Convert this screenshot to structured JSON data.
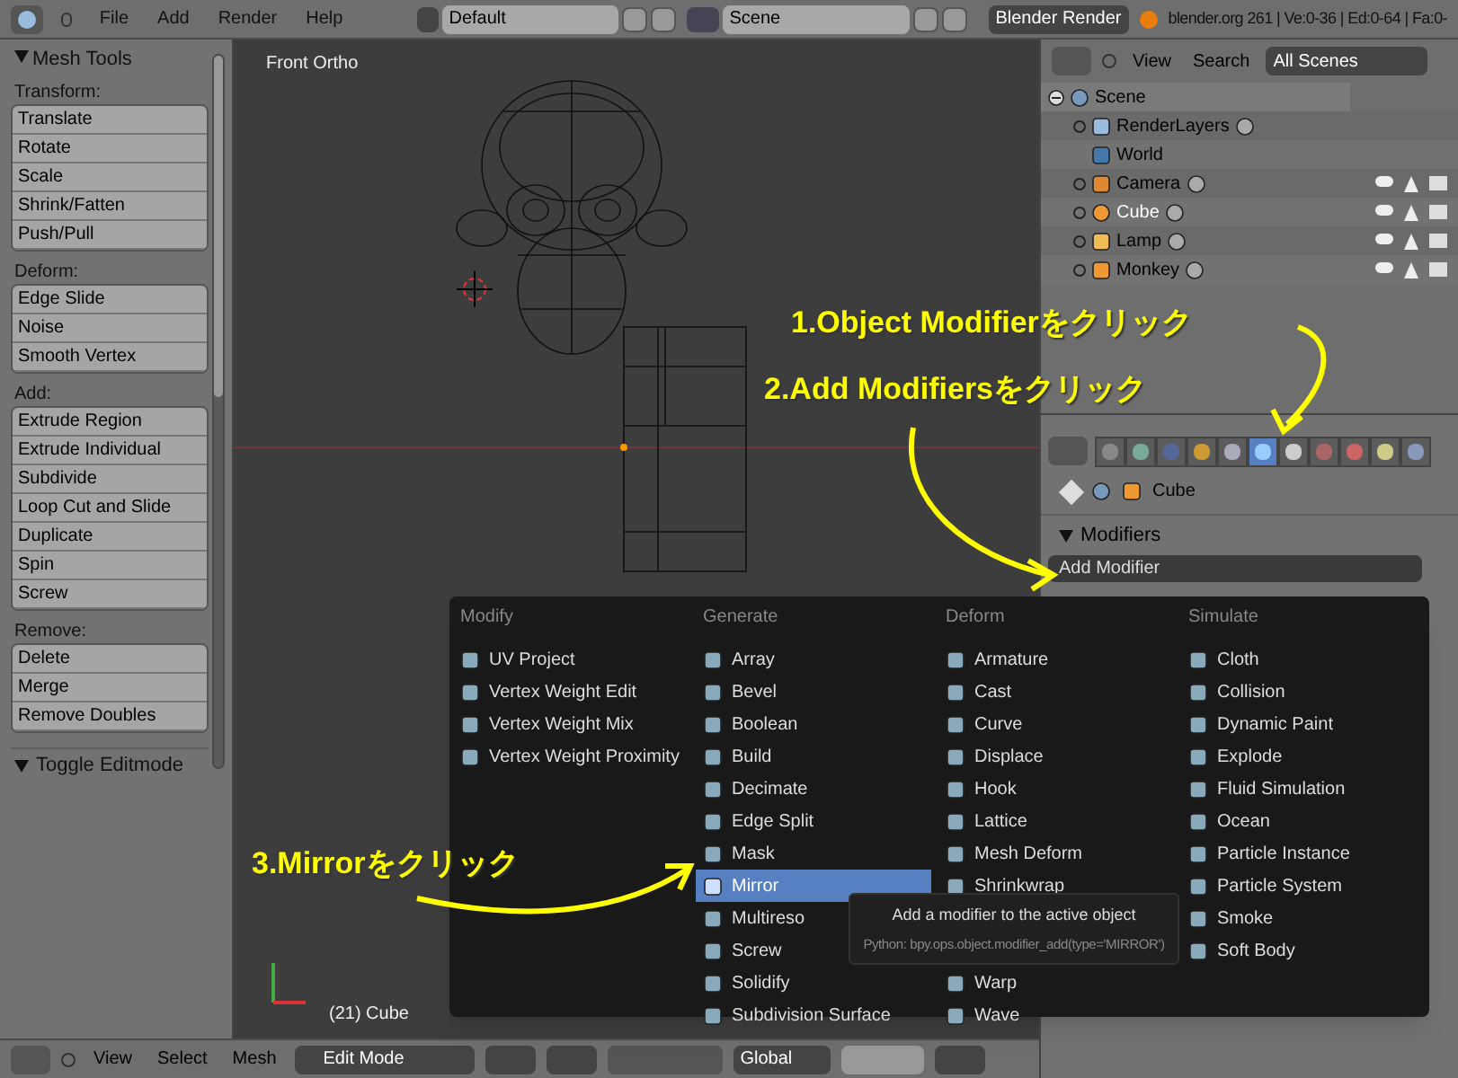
{
  "top_bar": {
    "menus": [
      "File",
      "Add",
      "Render",
      "Help"
    ],
    "layout": "Default",
    "scene": "Scene",
    "engine": "Blender Render",
    "stats": "blender.org 261 | Ve:0-36 | Ed:0-64 | Fa:0-"
  },
  "tool_shelf": {
    "title": "Mesh Tools",
    "groups": [
      {
        "label": "Transform:",
        "buttons": [
          "Translate",
          "Rotate",
          "Scale",
          "Shrink/Fatten",
          "Push/Pull"
        ]
      },
      {
        "label": "Deform:",
        "buttons": [
          "Edge Slide",
          "Noise",
          "Smooth Vertex"
        ]
      },
      {
        "label": "Add:",
        "buttons": [
          "Extrude Region",
          "Extrude Individual",
          "Subdivide",
          "Loop Cut and Slide",
          "Duplicate",
          "Spin",
          "Screw"
        ]
      },
      {
        "label": "Remove:",
        "buttons": [
          "Delete",
          "Merge",
          "Remove Doubles"
        ]
      }
    ],
    "collapsed_panel": "Toggle Editmode"
  },
  "viewport": {
    "view_label": "Front Ortho",
    "object_label": "(21) Cube"
  },
  "outliner": {
    "menus": [
      "View",
      "Search"
    ],
    "filter": "All Scenes",
    "scene": {
      "label": "Scene",
      "expanded": true
    },
    "items": [
      {
        "label": "RenderLayers",
        "kind": "layers",
        "selected": false
      },
      {
        "label": "World",
        "kind": "world",
        "selected": false
      },
      {
        "label": "Camera",
        "kind": "camera",
        "selected": false
      },
      {
        "label": "Cube",
        "kind": "mesh",
        "selected": true
      },
      {
        "label": "Lamp",
        "kind": "lamp",
        "selected": false
      },
      {
        "label": "Monkey",
        "kind": "mesh",
        "selected": false
      }
    ]
  },
  "properties": {
    "tabs": [
      {
        "kind": "render",
        "selected": false
      },
      {
        "kind": "scene",
        "selected": false
      },
      {
        "kind": "world",
        "selected": false
      },
      {
        "kind": "object",
        "selected": false
      },
      {
        "kind": "constraints",
        "selected": false
      },
      {
        "kind": "modifiers",
        "selected": true
      },
      {
        "kind": "data",
        "selected": false
      },
      {
        "kind": "material",
        "selected": false
      },
      {
        "kind": "texture",
        "selected": false
      },
      {
        "kind": "particles",
        "selected": false
      },
      {
        "kind": "physics",
        "selected": false
      }
    ],
    "breadcrumb": "Cube",
    "panel": "Modifiers",
    "dropdown": "Add Modifier"
  },
  "menu": {
    "columns": [
      {
        "title": "Modify",
        "items": [
          {
            "label": "UV Project",
            "selected": false
          },
          {
            "label": "Vertex Weight Edit",
            "selected": false
          },
          {
            "label": "Vertex Weight Mix",
            "selected": false
          },
          {
            "label": "Vertex Weight Proximity",
            "selected": false
          }
        ]
      },
      {
        "title": "Generate",
        "items": [
          {
            "label": "Array",
            "selected": false
          },
          {
            "label": "Bevel",
            "selected": false
          },
          {
            "label": "Boolean",
            "selected": false
          },
          {
            "label": "Build",
            "selected": false
          },
          {
            "label": "Decimate",
            "selected": false
          },
          {
            "label": "Edge Split",
            "selected": false
          },
          {
            "label": "Mask",
            "selected": false
          },
          {
            "label": "Mirror",
            "selected": true
          },
          {
            "label": "Multireso",
            "selected": false
          },
          {
            "label": "Screw",
            "selected": false
          },
          {
            "label": "Solidify",
            "selected": false
          },
          {
            "label": "Subdivision Surface",
            "selected": false
          }
        ]
      },
      {
        "title": "Deform",
        "items": [
          {
            "label": "Armature",
            "selected": false
          },
          {
            "label": "Cast",
            "selected": false
          },
          {
            "label": "Curve",
            "selected": false
          },
          {
            "label": "Displace",
            "selected": false
          },
          {
            "label": "Hook",
            "selected": false
          },
          {
            "label": "Lattice",
            "selected": false
          },
          {
            "label": "Mesh Deform",
            "selected": false
          },
          {
            "label": "Shrinkwrap",
            "selected": false
          }
        ],
        "items_after_tooltip": [
          {
            "label": "Warp",
            "selected": false
          },
          {
            "label": "Wave",
            "selected": false
          }
        ]
      },
      {
        "title": "Simulate",
        "items": [
          {
            "label": "Cloth",
            "selected": false
          },
          {
            "label": "Collision",
            "selected": false
          },
          {
            "label": "Dynamic Paint",
            "selected": false
          },
          {
            "label": "Explode",
            "selected": false
          },
          {
            "label": "Fluid Simulation",
            "selected": false
          },
          {
            "label": "Ocean",
            "selected": false
          },
          {
            "label": "Particle Instance",
            "selected": false
          },
          {
            "label": "Particle System",
            "selected": false
          },
          {
            "label": "Smoke",
            "selected": false
          },
          {
            "label": "Soft Body",
            "selected": false
          }
        ]
      }
    ]
  },
  "tooltip": {
    "text": "Add a modifier to the active object",
    "python": "Python: bpy.ops.object.modifier_add(type='MIRROR')"
  },
  "bottom_bar": {
    "menus": [
      "View",
      "Select",
      "Mesh"
    ],
    "mode": "Edit Mode",
    "orientation": "Global"
  },
  "annotations": [
    {
      "text": "1.Object Modifierをクリック"
    },
    {
      "text": "2.Add Modifiersをクリック"
    },
    {
      "text": "3.Mirrorをクリック"
    }
  ]
}
